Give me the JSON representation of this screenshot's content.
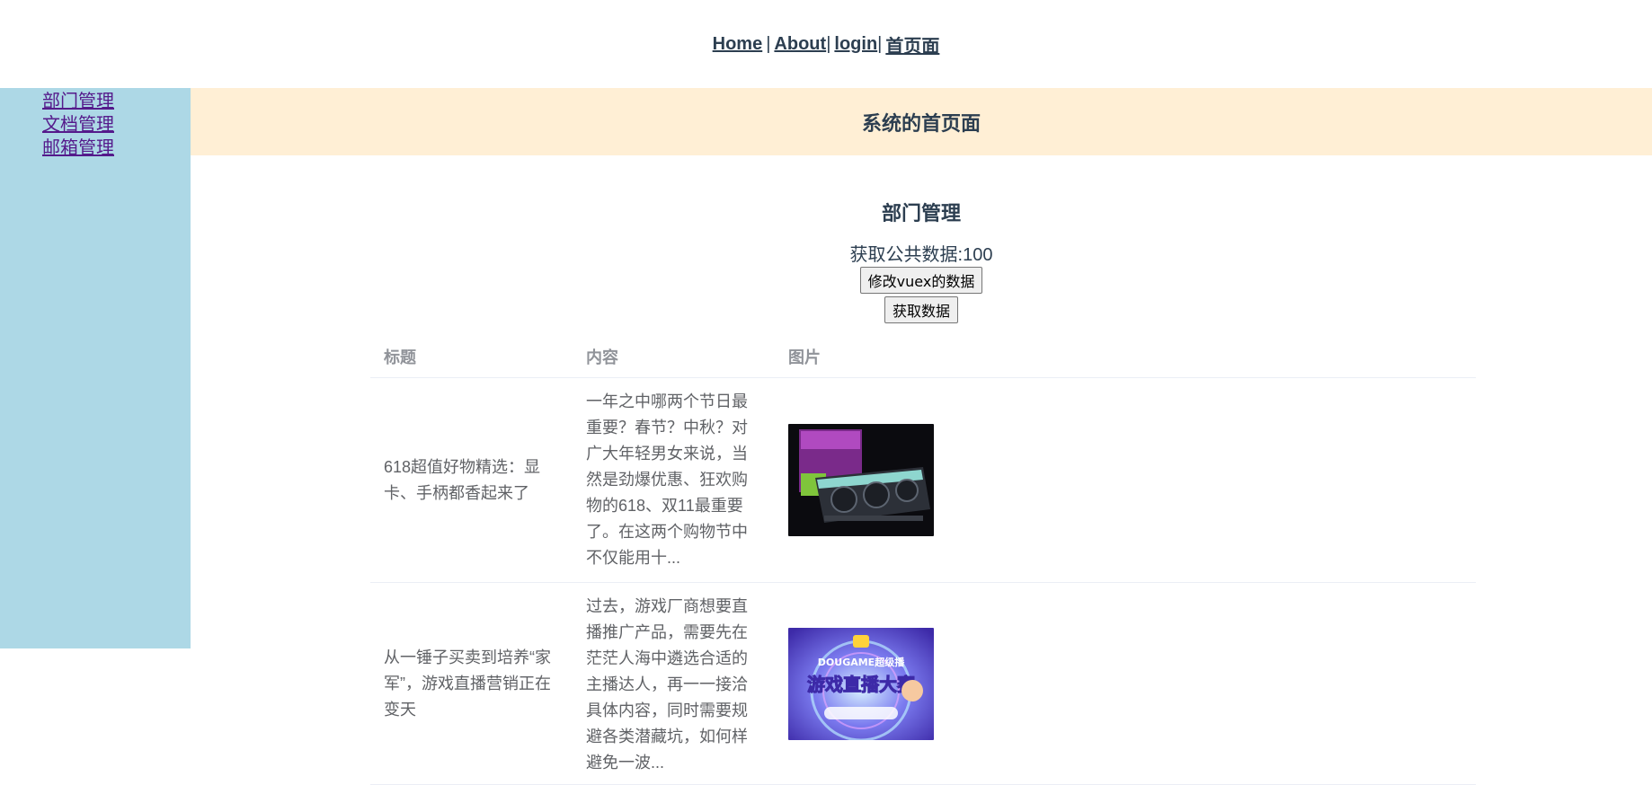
{
  "nav": {
    "home": "Home",
    "sep1": "|",
    "about": "About",
    "sep2": "|",
    "login": "login",
    "sep3": "|",
    "index": "首页面"
  },
  "sidebar": {
    "items": [
      {
        "label": "部门管理"
      },
      {
        "label": "文档管理"
      },
      {
        "label": "邮箱管理"
      }
    ]
  },
  "banner": {
    "title": "系统的首页面"
  },
  "main": {
    "heading": "部门管理",
    "public_data": "获取公共数据:100",
    "modify_button": "修改vuex的数据",
    "fetch_button": "获取数据"
  },
  "table": {
    "headers": [
      "标题",
      "内容",
      "图片"
    ],
    "rows": [
      {
        "title": "618超值好物精选：显卡、手柄都香起来了",
        "content": "一年之中哪两个节日最重要？春节？中秋？对广大年轻男女来说，当然是劲爆优惠、狂欢购物的618、双11最重要了。在这两个购物节中不仅能用十...",
        "image": "graphics-card-photo"
      },
      {
        "title": "从一锤子买卖到培养“家军”，游戏直播营销正在变天",
        "content": "过去，游戏厂商想要直播推广产品，需要先在茫茫人海中遴选合适的主播达人，再一一接洽具体内容，同时需要规避各类潜藏坑，如何样避免一波...",
        "image": "game-live-poster"
      }
    ]
  },
  "poster_text": {
    "brand": "DOUGAME超级播",
    "headline": "游戏直播大赛"
  },
  "colors": {
    "sidebar_bg": "#add8e6",
    "banner_bg": "#ffefd5",
    "text": "#2c3e50",
    "link_visited": "#551a8b",
    "table_header": "#909399",
    "table_cell": "#606266"
  }
}
